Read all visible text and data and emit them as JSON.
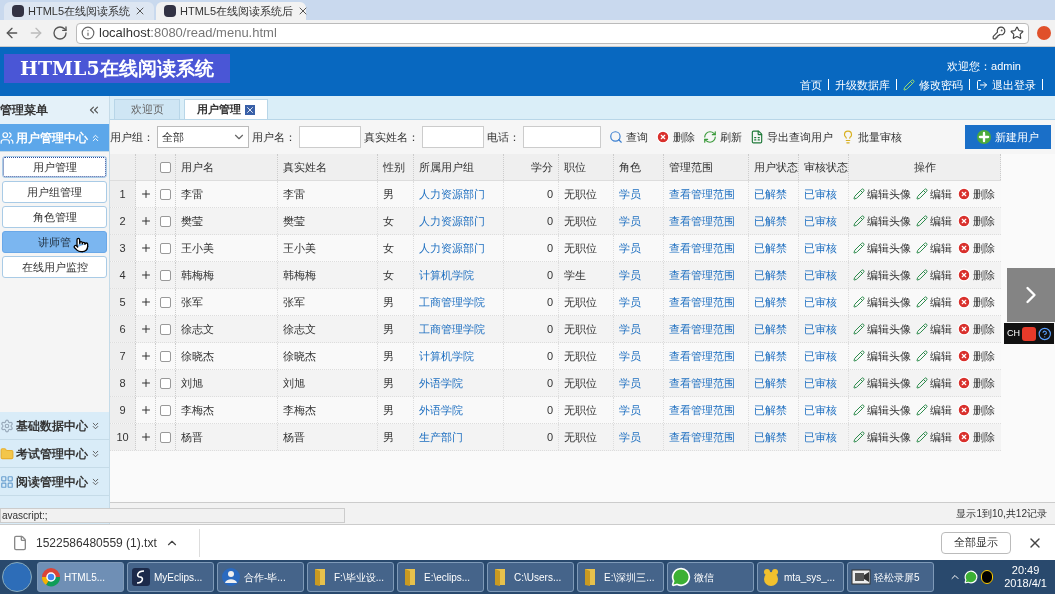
{
  "browser": {
    "tabs": [
      {
        "title": "HTML5在线阅读系统",
        "selected": false
      },
      {
        "title": "HTML5在线阅读系统后",
        "selected": true
      }
    ],
    "address": {
      "host": "localhost",
      "path": ":8080/read/menu.html"
    }
  },
  "header": {
    "title": "HTML5在线阅读系统",
    "welcome": "欢迎您：admin",
    "links": [
      {
        "label": "首页",
        "kind": "plain"
      },
      {
        "label": "升级数据库",
        "kind": "plain"
      },
      {
        "label": "修改密码",
        "kind": "edit"
      },
      {
        "label": "退出登录",
        "kind": "exit"
      }
    ]
  },
  "sidebar": {
    "title": "管理菜单",
    "groups": [
      {
        "label": "用户管理中心",
        "kind": "users",
        "expanded": true,
        "items": [
          {
            "label": "用户管理",
            "selected": true,
            "hovered": false
          },
          {
            "label": "用户组管理",
            "selected": false,
            "hovered": false
          },
          {
            "label": "角色管理",
            "selected": false,
            "hovered": false
          },
          {
            "label": "讲师管",
            "selected": false,
            "hovered": true
          },
          {
            "label": "在线用户监控",
            "selected": false,
            "hovered": false
          }
        ]
      },
      {
        "label": "基础数据中心",
        "kind": "data",
        "expanded": false
      },
      {
        "label": "考试管理中心",
        "kind": "exam",
        "expanded": false
      },
      {
        "label": "阅读管理中心",
        "kind": "reading",
        "expanded": false
      }
    ]
  },
  "tabs": [
    {
      "label": "欢迎页",
      "selected": false,
      "closable": false
    },
    {
      "label": "用户管理",
      "selected": true,
      "closable": true
    }
  ],
  "filters": [
    {
      "label": "用户组：",
      "kind": "select",
      "value": "全部"
    },
    {
      "label": "用户名：",
      "kind": "text"
    },
    {
      "label": "真实姓名：",
      "kind": "text"
    },
    {
      "label": "电话：",
      "kind": "text"
    }
  ],
  "actions": [
    {
      "label": "查询",
      "kind": "search"
    },
    {
      "label": "删除",
      "kind": "delete"
    },
    {
      "label": "刷新",
      "kind": "refresh"
    },
    {
      "label": "导出查询用户",
      "kind": "export"
    },
    {
      "label": "批量审核",
      "kind": "approve"
    }
  ],
  "new_button": "新建用户",
  "table": {
    "select_all_checked": false,
    "columns": [
      "用户名",
      "真实姓名",
      "性别",
      "所属用户组",
      "学分",
      "职位",
      "角色",
      "管理范围",
      "用户状态",
      "审核状态",
      "操作"
    ],
    "rows": [
      {
        "index": "1",
        "selected": false,
        "cells": [
          "李雷",
          "李雷",
          "男",
          "人力资源部门",
          "0",
          "无职位",
          "学员",
          "查看管理范围",
          "已解禁",
          "已审核"
        ],
        "actions": [
          {
            "kind": "edit",
            "label": "编辑头像"
          },
          {
            "kind": "edit",
            "label": "编辑"
          },
          {
            "kind": "delete",
            "label": "删除"
          }
        ]
      },
      {
        "index": "2",
        "selected": false,
        "cells": [
          "樊莹",
          "樊莹",
          "女",
          "人力资源部门",
          "0",
          "无职位",
          "学员",
          "查看管理范围",
          "已解禁",
          "已审核"
        ],
        "actions": [
          {
            "kind": "edit",
            "label": "编辑头像"
          },
          {
            "kind": "edit",
            "label": "编辑"
          },
          {
            "kind": "delete",
            "label": "删除"
          }
        ]
      },
      {
        "index": "3",
        "selected": false,
        "cells": [
          "王小美",
          "王小美",
          "女",
          "人力资源部门",
          "0",
          "无职位",
          "学员",
          "查看管理范围",
          "已解禁",
          "已审核"
        ],
        "actions": [
          {
            "kind": "edit",
            "label": "编辑头像"
          },
          {
            "kind": "edit",
            "label": "编辑"
          },
          {
            "kind": "delete",
            "label": "删除"
          }
        ]
      },
      {
        "index": "4",
        "selected": false,
        "cells": [
          "韩梅梅",
          "韩梅梅",
          "女",
          "计算机学院",
          "0",
          "学生",
          "学员",
          "查看管理范围",
          "已解禁",
          "已审核"
        ],
        "actions": [
          {
            "kind": "edit",
            "label": "编辑头像"
          },
          {
            "kind": "edit",
            "label": "编辑"
          },
          {
            "kind": "delete",
            "label": "删除"
          }
        ]
      },
      {
        "index": "5",
        "selected": false,
        "cells": [
          "张军",
          "张军",
          "男",
          "工商管理学院",
          "0",
          "无职位",
          "学员",
          "查看管理范围",
          "已解禁",
          "已审核"
        ],
        "actions": [
          {
            "kind": "edit",
            "label": "编辑头像"
          },
          {
            "kind": "edit",
            "label": "编辑"
          },
          {
            "kind": "delete",
            "label": "删除"
          }
        ]
      },
      {
        "index": "6",
        "selected": false,
        "cells": [
          "徐志文",
          "徐志文",
          "男",
          "工商管理学院",
          "0",
          "无职位",
          "学员",
          "查看管理范围",
          "已解禁",
          "已审核"
        ],
        "actions": [
          {
            "kind": "edit",
            "label": "编辑头像"
          },
          {
            "kind": "edit",
            "label": "编辑"
          },
          {
            "kind": "delete",
            "label": "删除"
          }
        ]
      },
      {
        "index": "7",
        "selected": false,
        "cells": [
          "徐晓杰",
          "徐晓杰",
          "男",
          "计算机学院",
          "0",
          "无职位",
          "学员",
          "查看管理范围",
          "已解禁",
          "已审核"
        ],
        "actions": [
          {
            "kind": "edit",
            "label": "编辑头像"
          },
          {
            "kind": "edit",
            "label": "编辑"
          },
          {
            "kind": "delete",
            "label": "删除"
          }
        ]
      },
      {
        "index": "8",
        "selected": false,
        "cells": [
          "刘旭",
          "刘旭",
          "男",
          "外语学院",
          "0",
          "无职位",
          "学员",
          "查看管理范围",
          "已解禁",
          "已审核"
        ],
        "actions": [
          {
            "kind": "edit",
            "label": "编辑头像"
          },
          {
            "kind": "edit",
            "label": "编辑"
          },
          {
            "kind": "delete",
            "label": "删除"
          }
        ]
      },
      {
        "index": "9",
        "selected": false,
        "cells": [
          "李梅杰",
          "李梅杰",
          "男",
          "外语学院",
          "0",
          "无职位",
          "学员",
          "查看管理范围",
          "已解禁",
          "已审核"
        ],
        "actions": [
          {
            "kind": "edit",
            "label": "编辑头像"
          },
          {
            "kind": "edit",
            "label": "编辑"
          },
          {
            "kind": "delete",
            "label": "删除"
          }
        ]
      },
      {
        "index": "10",
        "selected": false,
        "cells": [
          "杨晋",
          "杨晋",
          "男",
          "生产部门",
          "0",
          "无职位",
          "学员",
          "查看管理范围",
          "已解禁",
          "已审核"
        ],
        "actions": [
          {
            "kind": "edit",
            "label": "编辑头像"
          },
          {
            "kind": "edit",
            "label": "编辑"
          },
          {
            "kind": "delete",
            "label": "删除"
          }
        ]
      }
    ]
  },
  "pagination": {
    "summary": "显示1到10,共12记录"
  },
  "status_url": "avascript:;",
  "ime": {
    "label": "CH"
  },
  "download": {
    "file": "1522586480559 (1).txt",
    "show_all": "全部显示"
  },
  "taskbar": {
    "items": [
      {
        "label": "HTML5...",
        "kind": "browser",
        "selected": true
      },
      {
        "label": "MyEclips...",
        "kind": "ide",
        "selected": false
      },
      {
        "label": "合作-毕...",
        "kind": "contact",
        "selected": false
      },
      {
        "label": "F:\\毕业设...",
        "kind": "folder",
        "selected": false
      },
      {
        "label": "E:\\eclips...",
        "kind": "folder",
        "selected": false
      },
      {
        "label": "C:\\Users...",
        "kind": "folder",
        "selected": false
      },
      {
        "label": "E:\\深圳三...",
        "kind": "folder",
        "selected": false
      },
      {
        "label": "微信",
        "kind": "chat",
        "selected": false
      },
      {
        "label": "mta_sys_...",
        "kind": "app",
        "selected": false
      },
      {
        "label": "轻松录屏5",
        "kind": "recorder",
        "selected": false
      }
    ],
    "time": "20:49",
    "date": "2018/4/1"
  }
}
